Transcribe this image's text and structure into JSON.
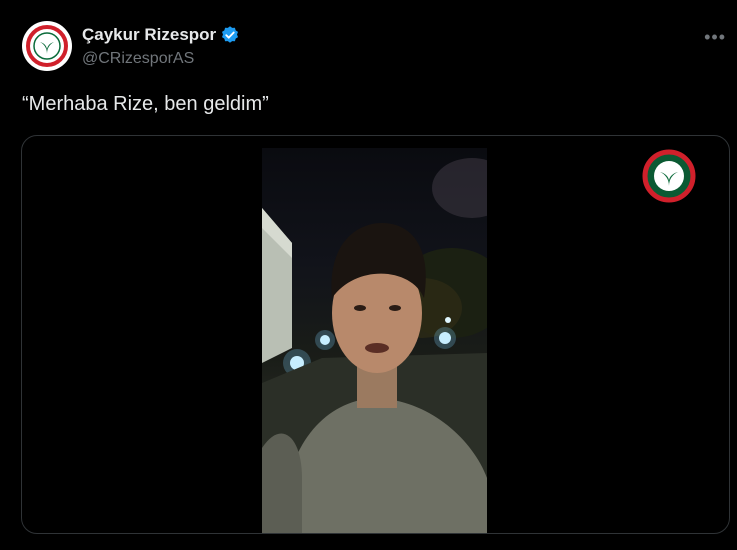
{
  "tweet": {
    "author": {
      "display_name": "Çaykur Rizespor",
      "handle": "@CRizesporAS",
      "verified_icon": "verified-badge-icon",
      "avatar_icon": "rizespor-crest-icon"
    },
    "more_icon": "more-options-icon",
    "text": "“Merhaba Rize, ben geldim”",
    "media": {
      "type": "video",
      "watermark_icon": "rizespor-crest-icon"
    }
  },
  "colors": {
    "background": "#000000",
    "text_primary": "#e7e9ea",
    "text_secondary": "#71767b",
    "verified_blue": "#1d9bf0",
    "border": "#2f3336"
  }
}
